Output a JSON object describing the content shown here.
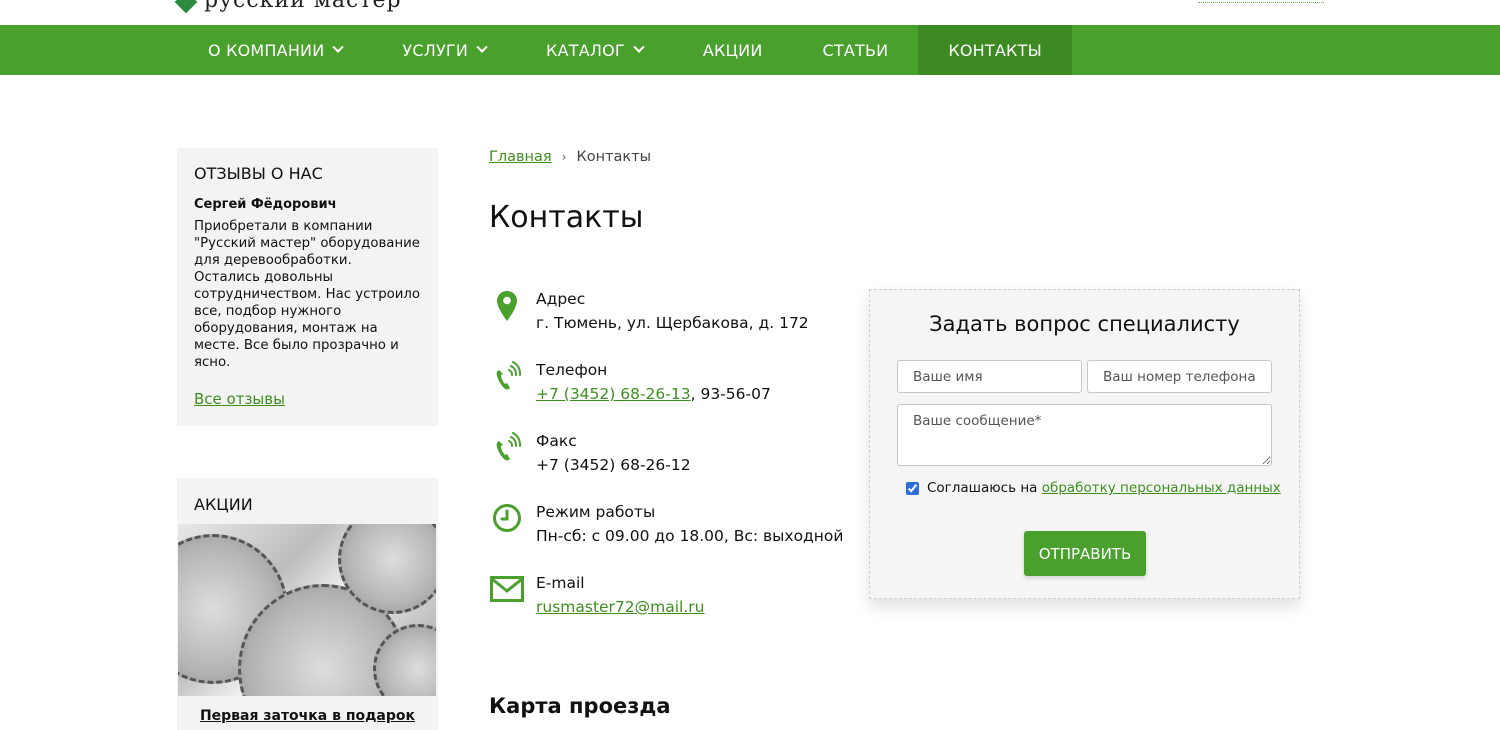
{
  "header": {
    "logo_text": "русский мастер"
  },
  "nav": {
    "items": [
      {
        "label": "О КОМПАНИИ",
        "has_dropdown": true
      },
      {
        "label": "УСЛУГИ",
        "has_dropdown": true
      },
      {
        "label": "КАТАЛОГ",
        "has_dropdown": true
      },
      {
        "label": "АКЦИИ",
        "has_dropdown": false
      },
      {
        "label": "СТАТЬИ",
        "has_dropdown": false
      },
      {
        "label": "КОНТАКТЫ",
        "has_dropdown": false,
        "active": true
      }
    ]
  },
  "sidebar": {
    "reviews": {
      "title": "ОТЗЫВЫ О НАС",
      "author": "Сергей Фёдорович",
      "text": "Приобретали в компании \"Русский мастер\" оборудование для деревообработки. Остались довольны сотрудничеством. Нас устроило все, подбор нужного оборудования, монтаж на месте. Все было прозрачно и ясно.",
      "all_link": "Все отзывы"
    },
    "promos": {
      "title": "АКЦИИ",
      "caption": "Первая заточка в подарок"
    }
  },
  "breadcrumb": {
    "home": "Главная",
    "separator": "›",
    "current": "Контакты"
  },
  "page_title": "Контакты",
  "contacts": {
    "address": {
      "label": "Адрес",
      "value": "г. Тюмень, ул. Щербакова, д. 172",
      "icon": "map-pin-icon"
    },
    "phone": {
      "label": "Телефон",
      "value_link": "+7 (3452) 68-26-13",
      "value_rest": ", 93-56-07",
      "icon": "phone-icon"
    },
    "fax": {
      "label": "Факс",
      "value": "+7 (3452) 68-26-12",
      "icon": "phone-icon"
    },
    "hours": {
      "label": "Режим работы",
      "value": "Пн-сб: с 09.00 до 18.00, Вс: выходной",
      "icon": "clock-icon"
    },
    "email": {
      "label": "E-mail",
      "value": "rusmaster72@mail.ru",
      "icon": "envelope-icon"
    }
  },
  "form": {
    "title": "Задать вопрос специалисту",
    "name_placeholder": "Ваше имя",
    "phone_placeholder": "Ваш номер телефона*",
    "message_placeholder": "Ваше сообщение*",
    "agree_text": "Соглашаюсь на ",
    "agree_link": "обработку персональных данных",
    "agree_checked": true,
    "submit_label": "ОТПРАВИТЬ"
  },
  "map": {
    "title": "Карта проезда"
  },
  "colors": {
    "brand_green": "#4aa02c",
    "nav_active": "#3d8a22",
    "link_green": "#3d8f1f"
  }
}
